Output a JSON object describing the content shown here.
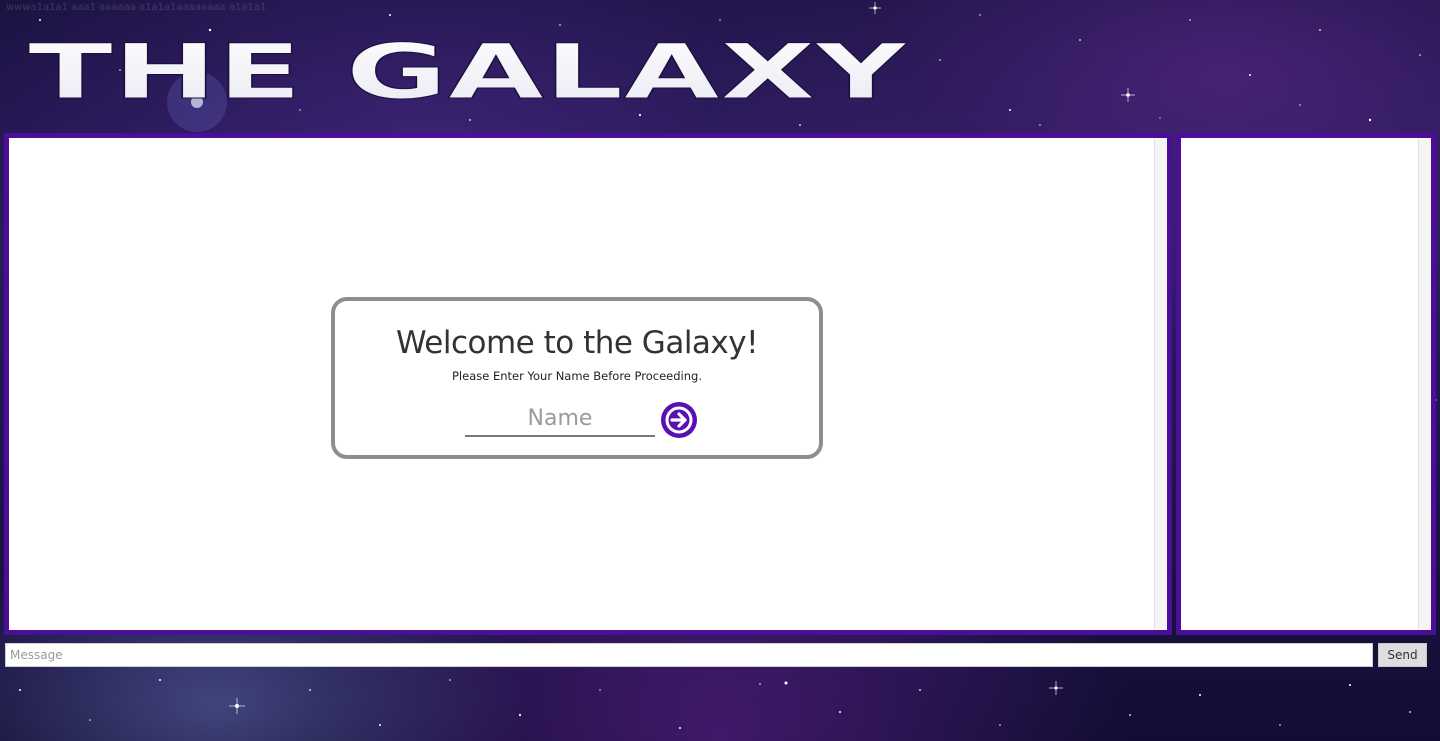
{
  "header": {
    "logo_text": "THE GALAXY",
    "faint_text": "wwwa1a1a1 aaa1 aaaaaa a1a1a1aaaaaaaa a1a1a1"
  },
  "welcome": {
    "title": "Welcome to the Galaxy!",
    "subtitle": "Please Enter Your Name Before Proceeding.",
    "name_placeholder": "Name",
    "name_value": "",
    "submit_icon": "arrow-right-circle-icon"
  },
  "chat": {
    "message_placeholder": "Message",
    "message_value": "",
    "send_label": "Send"
  },
  "colors": {
    "accent": "#4b0f97",
    "button": "#5a0fb3",
    "card_border": "#8e8e8e"
  }
}
